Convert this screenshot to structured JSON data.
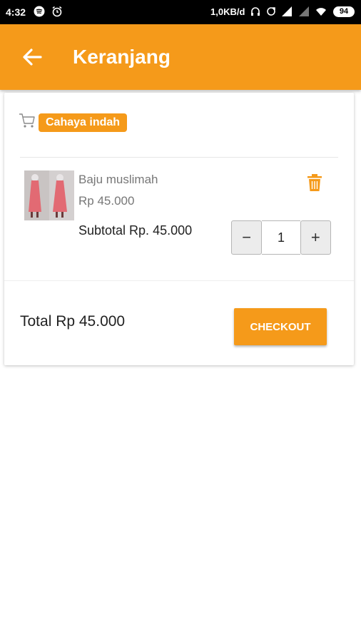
{
  "status_bar": {
    "time": "4:32",
    "network_speed": "1,0KB/d",
    "battery": "94"
  },
  "app_bar": {
    "title": "Keranjang"
  },
  "store": {
    "name": "Cahaya indah"
  },
  "cart_item": {
    "name": "Baju muslimah",
    "price": "Rp 45.000",
    "subtotal": "Subtotal Rp. 45.000",
    "quantity": "1",
    "decrement_label": "−",
    "increment_label": "+"
  },
  "summary": {
    "total": "Total Rp 45.000",
    "checkout_label": "CHECKOUT"
  },
  "colors": {
    "accent": "#f59a1a"
  },
  "icons": [
    "spotify-icon",
    "alarm-icon",
    "headset-icon",
    "sync-icon",
    "signal-icon",
    "wifi-icon",
    "back-arrow-icon",
    "cart-icon",
    "trash-icon"
  ]
}
